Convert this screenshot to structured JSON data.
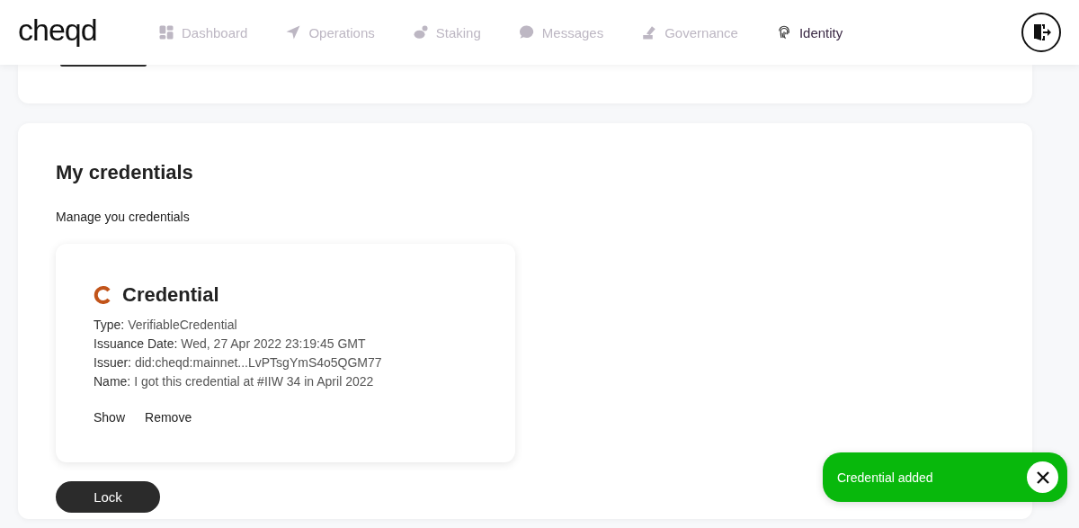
{
  "header": {
    "logo": "cheqd",
    "nav": [
      {
        "label": "Dashboard",
        "selected": false
      },
      {
        "label": "Operations",
        "selected": false
      },
      {
        "label": "Staking",
        "selected": false
      },
      {
        "label": "Messages",
        "selected": false
      },
      {
        "label": "Governance",
        "selected": false
      },
      {
        "label": "Identity",
        "selected": true
      }
    ]
  },
  "credentials_section": {
    "title": "My credentials",
    "subtitle": "Manage you credentials",
    "credential": {
      "title": "Credential",
      "fields": [
        {
          "label": "Type:",
          "value": "VerifiableCredential"
        },
        {
          "label": "Issuance Date:",
          "value": "Wed, 27 Apr 2022 23:19:45 GMT"
        },
        {
          "label": "Issuer:",
          "value": "did:cheqd:mainnet...LvPTsgYmS4o5QGM77"
        },
        {
          "label": "Name:",
          "value": "I got this credential at #IIW 34 in April 2022"
        }
      ],
      "actions": [
        "Show",
        "Remove"
      ]
    },
    "lock_button": "Lock"
  },
  "toast": {
    "message": "Credential added"
  }
}
